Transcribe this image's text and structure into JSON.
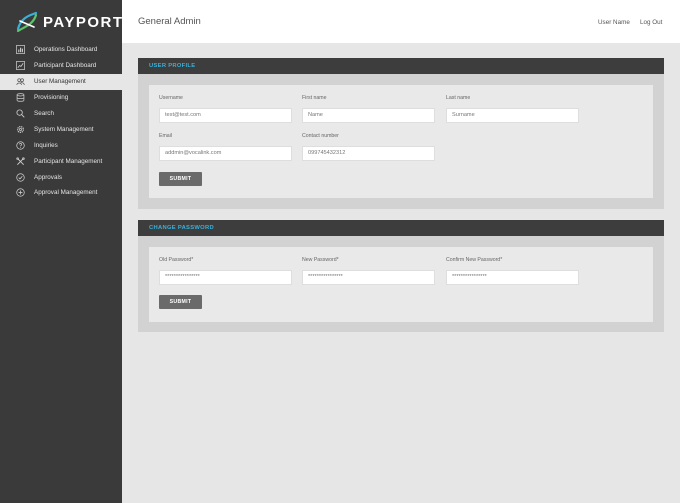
{
  "brand": {
    "logo_text": "PAYPORT",
    "accent": "#3ab0d9"
  },
  "sidebar": {
    "items": [
      {
        "label": "Operations Dashboard",
        "icon": "bar-chart-icon"
      },
      {
        "label": "Participant Dashboard",
        "icon": "line-chart-icon"
      },
      {
        "label": "User Management",
        "icon": "users-icon",
        "active": true
      },
      {
        "label": "Provisioning",
        "icon": "database-icon"
      },
      {
        "label": "Search",
        "icon": "search-icon"
      },
      {
        "label": "System Management",
        "icon": "gear-icon"
      },
      {
        "label": "Inquiries",
        "icon": "question-icon"
      },
      {
        "label": "Participant Management",
        "icon": "tools-icon"
      },
      {
        "label": "Approvals",
        "icon": "check-circle-icon"
      },
      {
        "label": "Approval Management",
        "icon": "plus-circle-icon"
      }
    ]
  },
  "header": {
    "title": "General Admin",
    "user_name": "User Name",
    "logout": "Log Out"
  },
  "user_profile": {
    "heading": "USER PROFILE",
    "username": {
      "label": "Username",
      "value": "test@test.com"
    },
    "first_name": {
      "label": "First name",
      "value": "Name"
    },
    "last_name": {
      "label": "Last name",
      "value": "Surname"
    },
    "email": {
      "label": "Email",
      "value": "addmin@vocalink.com"
    },
    "contact": {
      "label": "Contact number",
      "value": "099745432312"
    },
    "submit": "SUBMIT"
  },
  "change_password": {
    "heading": "CHANGE PASSWORD",
    "old_password": {
      "label": "Old Password*",
      "value": "****************"
    },
    "new_password": {
      "label": "New Password*",
      "value": "****************"
    },
    "confirm_password": {
      "label": "Confirm New Password*",
      "value": "****************"
    },
    "submit": "SUBMIT"
  }
}
